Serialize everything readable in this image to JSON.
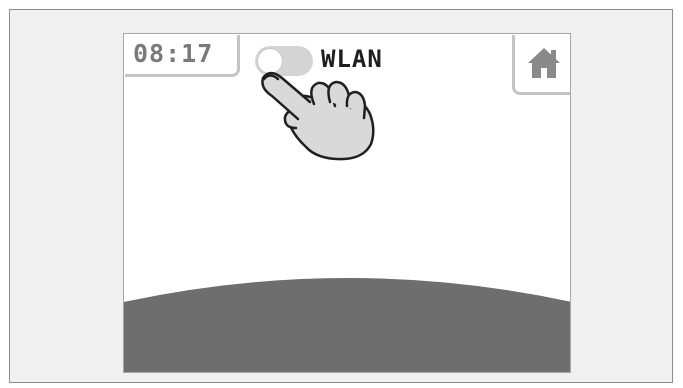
{
  "status_bar": {
    "time": "08:17"
  },
  "wlan": {
    "label": "WLAN",
    "enabled": false
  },
  "icons": {
    "home": "home-icon",
    "gesture": "tap-hand-icon"
  },
  "colors": {
    "ground": "#6e6e6e",
    "frame_background": "#f0f0f0",
    "toggle_off": "#d4d4d4",
    "text": "#1e1e1e",
    "icon": "#8a8a8a"
  }
}
